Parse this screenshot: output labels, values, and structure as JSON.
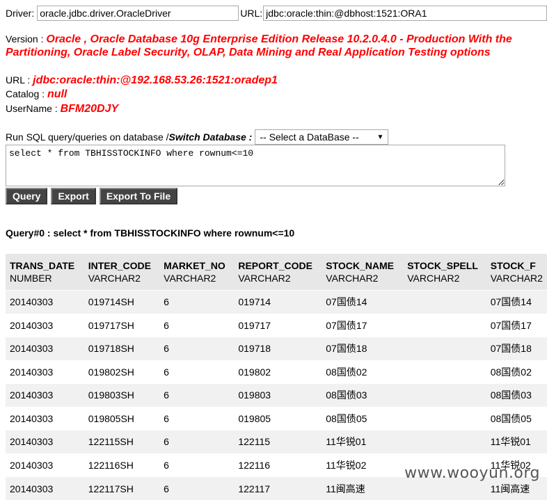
{
  "connection": {
    "driver_label": "Driver:",
    "driver_value": "oracle.jdbc.driver.OracleDriver",
    "url_label": "URL:",
    "url_value": "jdbc:oracle:thin:@dbhost:1521:ORA1"
  },
  "info": {
    "version_label": "Version : ",
    "version_value": "Oracle , Oracle Database 10g Enterprise Edition Release 10.2.0.4.0 - Production With the Partitioning, Oracle Label Security, OLAP, Data Mining and Real Application Testing options",
    "url_label": "URL : ",
    "url_value": "jdbc:oracle:thin:@192.168.53.26:1521:oradep1",
    "catalog_label": "Catalog : ",
    "catalog_value": "null",
    "username_label": "UserName : ",
    "username_value": "BFM20DJY"
  },
  "run": {
    "prompt": "Run SQL query/queries on database / ",
    "switch_label": "Switch Database :",
    "select_value": "-- Select a DataBase --",
    "sql_text": "select * from TBHISSTOCKINFO where rownum<=10"
  },
  "buttons": {
    "query": "Query",
    "export": "Export",
    "export_file": "Export To File"
  },
  "result": {
    "title": "Query#0 : select * from TBHISSTOCKINFO where rownum<=10",
    "columns": [
      {
        "name": "TRANS_DATE",
        "type": "NUMBER"
      },
      {
        "name": "INTER_CODE",
        "type": "VARCHAR2"
      },
      {
        "name": "MARKET_NO",
        "type": "VARCHAR2"
      },
      {
        "name": "REPORT_CODE",
        "type": "VARCHAR2"
      },
      {
        "name": "STOCK_NAME",
        "type": "VARCHAR2"
      },
      {
        "name": "STOCK_SPELL",
        "type": "VARCHAR2"
      },
      {
        "name": "STOCK_F",
        "type": "VARCHAR2"
      }
    ],
    "rows": [
      [
        "20140303",
        "019714SH",
        "6",
        "019714",
        "07国债14",
        "",
        "07国债14"
      ],
      [
        "20140303",
        "019717SH",
        "6",
        "019717",
        "07国债17",
        "",
        "07国债17"
      ],
      [
        "20140303",
        "019718SH",
        "6",
        "019718",
        "07国债18",
        "",
        "07国债18"
      ],
      [
        "20140303",
        "019802SH",
        "6",
        "019802",
        "08国债02",
        "",
        "08国债02"
      ],
      [
        "20140303",
        "019803SH",
        "6",
        "019803",
        "08国债03",
        "",
        "08国债03"
      ],
      [
        "20140303",
        "019805SH",
        "6",
        "019805",
        "08国债05",
        "",
        "08国债05"
      ],
      [
        "20140303",
        "122115SH",
        "6",
        "122115",
        "11华锐01",
        "",
        "11华锐01"
      ],
      [
        "20140303",
        "122116SH",
        "6",
        "122116",
        "11华锐02",
        "",
        "11华锐02"
      ],
      [
        "20140303",
        "122117SH",
        "6",
        "122117",
        "11闽高速",
        "",
        "11闽高速"
      ]
    ]
  },
  "watermark": "www.wooyun.org"
}
